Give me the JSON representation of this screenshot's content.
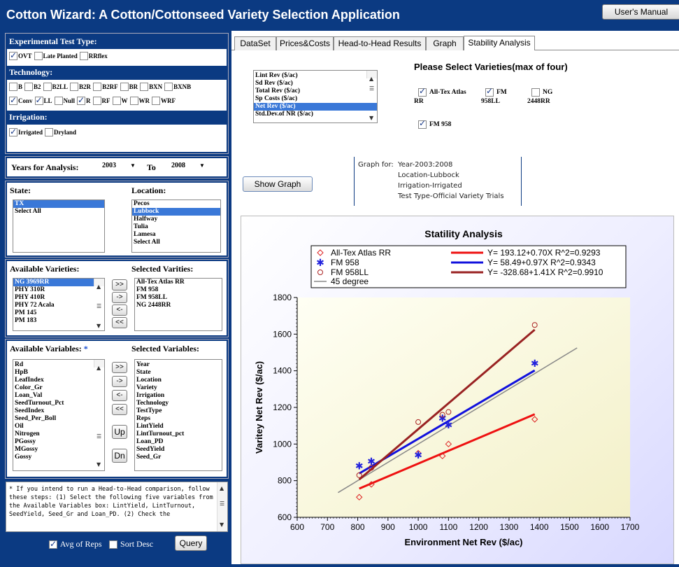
{
  "app_title": "Cotton Wizard:  A Cotton/Cottonseed Variety Selection Application",
  "manual_button": "User's Manual",
  "test_type": {
    "header": "Experimental Test Type:",
    "options": [
      {
        "label": "OVT",
        "checked": true
      },
      {
        "label": "Late Planted",
        "checked": false
      },
      {
        "label": "RRflex",
        "checked": false
      }
    ]
  },
  "technology": {
    "header": "Technology:",
    "row1": [
      {
        "label": "B",
        "checked": false
      },
      {
        "label": "B2",
        "checked": false
      },
      {
        "label": "B2LL",
        "checked": false
      },
      {
        "label": "B2R",
        "checked": false
      },
      {
        "label": "B2RF",
        "checked": false
      },
      {
        "label": "BR",
        "checked": false
      },
      {
        "label": "BXN",
        "checked": false
      },
      {
        "label": "BXNB",
        "checked": false
      }
    ],
    "row2": [
      {
        "label": "Conv",
        "checked": true
      },
      {
        "label": "LL",
        "checked": true
      },
      {
        "label": "Null",
        "checked": false
      },
      {
        "label": "R",
        "checked": true
      },
      {
        "label": "RF",
        "checked": false
      },
      {
        "label": "W",
        "checked": false
      },
      {
        "label": "WR",
        "checked": false
      },
      {
        "label": "WRF",
        "checked": false
      }
    ]
  },
  "irrigation": {
    "header": "Irrigation:",
    "options": [
      {
        "label": "Irrigated",
        "checked": true
      },
      {
        "label": "Dryland",
        "checked": false
      }
    ]
  },
  "years": {
    "label": "Years for Analysis:",
    "from": "2003",
    "to_label": "To",
    "to": "2008"
  },
  "state": {
    "label": "State:",
    "items": [
      "TX",
      "Select All"
    ],
    "selected": 0
  },
  "location": {
    "label": "Location:",
    "items": [
      "Pecos",
      "Lubbock",
      "Halfway",
      "Tulia",
      "Lamesa",
      "Select All"
    ],
    "selected": 1
  },
  "varieties": {
    "available_label": "Available Varieties:",
    "selected_label": "Selected Varities:",
    "available": [
      "NG 3969RR",
      "PHY 310R",
      "PHY 410R",
      "PHY 72 Acala",
      "PM 145",
      "PM 183"
    ],
    "available_selected": 0,
    "selected": [
      "All-Tex Atlas RR",
      "FM 958",
      "FM 958LL",
      "NG 2448RR"
    ],
    "buttons": [
      ">>",
      "->",
      "<-",
      "<<"
    ]
  },
  "variables": {
    "available_label": "Available Variables:",
    "asterisk": "*",
    "selected_label": "Selected Variables:",
    "available": [
      "Rd",
      "HpB",
      "LeafIndex",
      "Color_Gr",
      "Loan_Val",
      "SeedTurnout_Pct",
      "SeedIndex",
      "Seed_Per_Boll",
      "Oil",
      "Nitrogen",
      "PGossy",
      "MGossy",
      "Gossy"
    ],
    "selected": [
      "Year",
      "State",
      "Location",
      "Variety",
      "Irrigation",
      "Technology",
      "TestType",
      "Reps",
      "LintYield",
      "LintTurnout_pct",
      "Loan_PD",
      "SeedYield",
      "Seed_Gr"
    ],
    "buttons": [
      ">>",
      "->",
      "<-",
      "<<",
      "Up",
      "Dn"
    ]
  },
  "notes": "* If you intend to run a Head-to-Head comparison, follow these steps: (1) Select the following five variables from the Available Variables box: LintYield, LintTurnout, SeedYield, Seed_Gr and Loan_PD. (2) Check the",
  "bottom": {
    "avg_reps": "Avg of Reps",
    "avg_checked": true,
    "sort_desc": "Sort Desc",
    "sort_checked": false,
    "query": "Query"
  },
  "tabs": [
    "DataSet",
    "Prices&Costs",
    "Head-to-Head Results",
    "Graph",
    "Stability Analysis"
  ],
  "active_tab": 4,
  "measures": {
    "items": [
      "Lint Rev ($/ac)",
      "Sd Rev ($/ac)",
      "Total Rev ($/ac)",
      "Sp Costs ($/ac)",
      "Net Rev ($/ac)",
      "Std.Dev.of NR ($/ac)"
    ],
    "selected": 4
  },
  "select_heading": "Please Select Varieties(max of four)",
  "variety_checks": [
    {
      "label": "All-Tex Atlas",
      "label2": "RR",
      "checked": true
    },
    {
      "label": "FM",
      "label2": "958LL",
      "checked": true
    },
    {
      "label": "NG",
      "label2": "2448RR",
      "checked": false
    },
    {
      "label": "FM 958",
      "label2": "",
      "checked": true
    }
  ],
  "show_graph": "Show Graph",
  "graph_info": {
    "prefix": "Graph for:",
    "lines": [
      "Year-2003:2008",
      "Location-Lubbock",
      "Irrigation-Irrigated",
      "Test Type-Official Variety Trials"
    ]
  },
  "chart_data": {
    "type": "scatter",
    "title": "Statility Analysis",
    "xlabel": "Environment Net Rev ($/ac)",
    "ylabel": "Varitey  Net Rev ($/ac)",
    "xlim": [
      600,
      1700
    ],
    "ylim": [
      600,
      1800
    ],
    "xticks": [
      600,
      700,
      800,
      900,
      1000,
      1100,
      1200,
      1300,
      1400,
      1500,
      1600,
      1700
    ],
    "yticks": [
      600,
      800,
      1000,
      1200,
      1400,
      1600,
      1800
    ],
    "legend_position": "top",
    "series": [
      {
        "name": "All-Tex Atlas RR",
        "marker": "diamond",
        "color": "#dd2222",
        "points": [
          [
            805,
            710
          ],
          [
            845,
            780
          ],
          [
            1000,
            950
          ],
          [
            1080,
            935
          ],
          [
            1100,
            1000
          ],
          [
            1385,
            1135
          ]
        ]
      },
      {
        "name": "FM 958",
        "marker": "star",
        "color": "#2222dd",
        "points": [
          [
            805,
            880
          ],
          [
            845,
            905
          ],
          [
            1000,
            940
          ],
          [
            1080,
            1140
          ],
          [
            1100,
            1105
          ],
          [
            1385,
            1440
          ]
        ]
      },
      {
        "name": "FM 958LL",
        "marker": "circle",
        "color": "#aa2222",
        "points": [
          [
            805,
            830
          ],
          [
            845,
            870
          ],
          [
            1000,
            1120
          ],
          [
            1080,
            1160
          ],
          [
            1100,
            1175
          ],
          [
            1385,
            1650
          ]
        ]
      }
    ],
    "fits": [
      {
        "label": "Y= 193.12+0.70X  R^2=0.9293",
        "color": "#ee1111",
        "x": [
          805,
          1385
        ],
        "intercept": 193.12,
        "slope": 0.7
      },
      {
        "label": "Y= 58.49+0.97X  R^2=0.9343",
        "color": "#1111dd",
        "x": [
          805,
          1385
        ],
        "intercept": 58.49,
        "slope": 0.97
      },
      {
        "label": "Y= -328.68+1.41X  R^2=0.9910",
        "color": "#992222",
        "x": [
          805,
          1385
        ],
        "intercept": -328.68,
        "slope": 1.41
      }
    ],
    "reference": {
      "label": "45 degree",
      "color": "#888888",
      "x": [
        735,
        1525
      ]
    }
  }
}
